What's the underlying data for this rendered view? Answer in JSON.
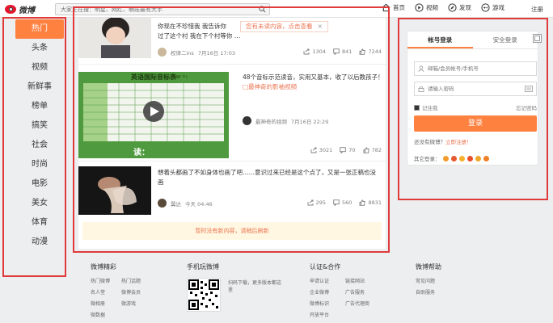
{
  "header": {
    "logo_text": "微博",
    "search_placeholder": "大家正在搜：明星、网红、萌娃最有大手",
    "nav": [
      {
        "label": "首页",
        "icon": "home-icon"
      },
      {
        "label": "视频",
        "icon": "video-icon"
      },
      {
        "label": "发现",
        "icon": "discover-icon"
      },
      {
        "label": "游戏",
        "icon": "game-icon"
      }
    ],
    "register_label": "注册"
  },
  "sidebar": {
    "items": [
      {
        "label": "热门",
        "active": true
      },
      {
        "label": "头条"
      },
      {
        "label": "视频"
      },
      {
        "label": "新鲜事"
      },
      {
        "label": "榜单"
      },
      {
        "label": "搞笑"
      },
      {
        "label": "社会"
      },
      {
        "label": "时尚"
      },
      {
        "label": "电影"
      },
      {
        "label": "美女"
      },
      {
        "label": "体育"
      },
      {
        "label": "动漫"
      }
    ]
  },
  "feed": {
    "notice_text": "您有未读内容，点击查看",
    "notice_close": "×",
    "posts": [
      {
        "text_main": "你现在不珍惜我 我告诉你",
        "text_rest": "过了这个村 我在下个村等你 …",
        "author": "权律二ins",
        "time": "7月16日 17:03",
        "shares": "1304",
        "comments": "841",
        "likes": "7244"
      },
      {
        "text": "48个音标示范读音，实用又基本，收了以后教孩子！",
        "link": "□最神奇的影袖视频",
        "author": "最神奇的视频",
        "time": "7月16日 22:29",
        "thumb_title": "英语国际音标表",
        "thumb_subtitle": "(48 个)",
        "thumb_bottom": "读：",
        "shares": "3021",
        "comments": "70",
        "likes": "782"
      },
      {
        "text": "想着头都画了不如身体也画了吧……意识过来已经是这个点了，又是一张正稿也没画",
        "author": "翼达",
        "time": "今天 04:46",
        "shares": "295",
        "comments": "560",
        "likes": "8831"
      }
    ],
    "no_more": "暂时没有新内容，请稍后刷新"
  },
  "login": {
    "tab_account": "帐号登录",
    "tab_secure": "安全登录",
    "username_placeholder": "邮箱/会员帐号/手机号",
    "password_placeholder": "请输入密码",
    "remember": "记住我",
    "forgot": "忘记密码",
    "submit": "登录",
    "no_account": "还没有微博？",
    "register_link": "立即注册！",
    "other_login": "其它登录："
  },
  "footer": {
    "col1_title": "微博精彩",
    "col1_links": [
      "热门微博",
      "热门话题",
      "名人堂",
      "微博会员",
      "微相册",
      "微游戏",
      "微数据"
    ],
    "col2_title": "手机玩微博",
    "col2_text": "扫码下载，更多版本都这里",
    "col3_title": "认证&合作",
    "col3_links": [
      "申请认证",
      "链接网站",
      "企业微博",
      "广告服务",
      "微博标识",
      "广告代理商",
      "开放平台"
    ],
    "col4_title": "微博帮助",
    "col4_links": [
      "常见问题",
      "自助服务"
    ]
  },
  "colors": {
    "accent": "#ff8140",
    "highlight": "#eb7350",
    "annotation": "#e03a3a"
  }
}
